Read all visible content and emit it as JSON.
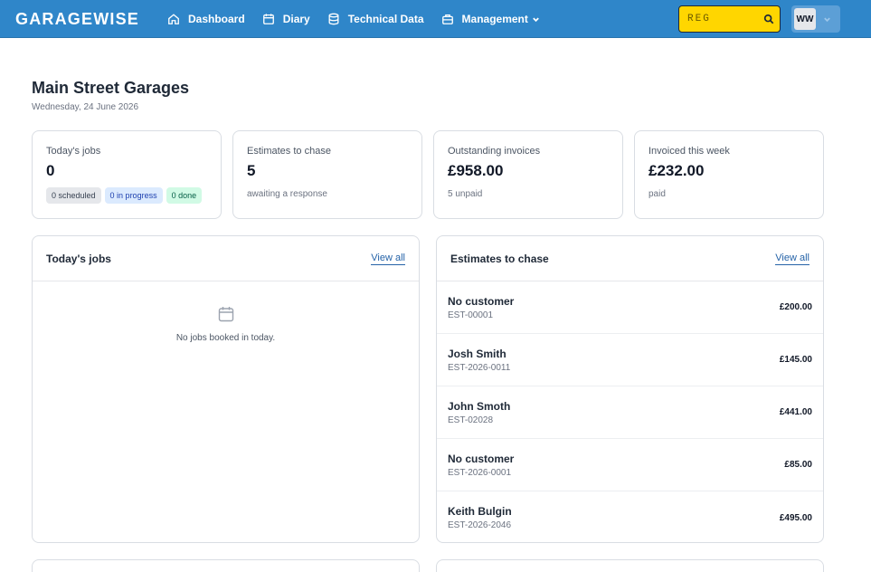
{
  "app": {
    "logo": "GARAGEWISE"
  },
  "nav": {
    "items": [
      {
        "label": "Dashboard",
        "icon": "home-icon"
      },
      {
        "label": "Diary",
        "icon": "calendar-icon"
      },
      {
        "label": "Technical Data",
        "icon": "database-icon"
      },
      {
        "label": "Management",
        "icon": "briefcase-icon"
      }
    ]
  },
  "search": {
    "placeholder": "REG",
    "icon": "search-icon"
  },
  "user": {
    "initials": "WW"
  },
  "page": {
    "title": "Main Street Garages",
    "date": "Wednesday, 24 June 2026"
  },
  "stats": [
    {
      "label": "Today's jobs",
      "value": "0",
      "badges": [
        "0 scheduled",
        "0 in progress",
        "0 done"
      ]
    },
    {
      "label": "Estimates to chase",
      "value": "5",
      "sub": "awaiting a response"
    },
    {
      "label": "Outstanding invoices",
      "value": "£958.00",
      "sub": "5 unpaid"
    },
    {
      "label": "Invoiced this week",
      "value": "£232.00",
      "sub": "paid"
    }
  ],
  "jobs_panel": {
    "title": "Today's jobs",
    "view_all": "View all",
    "empty": "No jobs booked in today."
  },
  "estimates_panel": {
    "title": "Estimates to chase",
    "view_all": "View all",
    "rows": [
      {
        "name": "No customer",
        "ref": "EST-00001",
        "amount": "£200.00"
      },
      {
        "name": "Josh Smith",
        "ref": "EST-2026-0011",
        "amount": "£145.00"
      },
      {
        "name": "John Smoth",
        "ref": "EST-02028",
        "amount": "£441.00"
      },
      {
        "name": "No customer",
        "ref": "EST-2026-0001",
        "amount": "£85.00"
      },
      {
        "name": "Keith Bulgin",
        "ref": "EST-2026-2046",
        "amount": "£495.00"
      }
    ]
  },
  "colors": {
    "topbar": "#2f86c9",
    "reg_plate": "#ffd600",
    "link": "#2563a8"
  }
}
